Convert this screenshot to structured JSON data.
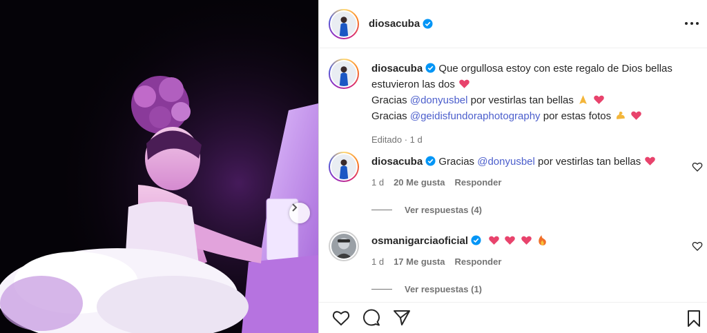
{
  "post": {
    "username": "diosacuba",
    "caption": {
      "line1_text": "Que orgullosa estoy con este regalo de Dios bellas estuvieron las dos",
      "line2_prefix": "Gracias",
      "line2_mention": "@donyusbel",
      "line2_suffix": "por vestirlas tan bellas",
      "line3_prefix": "Gracias",
      "line3_mention": "@geidisfundoraphotography",
      "line3_suffix": "por estas fotos",
      "meta": "Editado · 1 d"
    }
  },
  "comments": [
    {
      "username": "diosacuba",
      "text_prefix": "Gracias",
      "mention": "@donyusbel",
      "text_suffix": "por vestirlas tan bellas",
      "age": "1 d",
      "likes": "20 Me gusta",
      "reply": "Responder",
      "view_replies": "Ver respuestas (4)"
    },
    {
      "username": "osmanigarciaoficial",
      "age": "1 d",
      "likes": "17 Me gusta",
      "reply": "Responder",
      "view_replies": "Ver respuestas (1)"
    }
  ],
  "icons": {
    "more": "more-options-icon",
    "like": "heart-icon",
    "comment": "comment-icon",
    "share": "share-icon",
    "save": "bookmark-icon",
    "verified": "verified-badge-icon",
    "next": "chevron-right-icon"
  },
  "colors": {
    "mention": "#4b5ecc",
    "verified": "#0095f6",
    "heart": "#e8436c",
    "meta": "#737373"
  }
}
